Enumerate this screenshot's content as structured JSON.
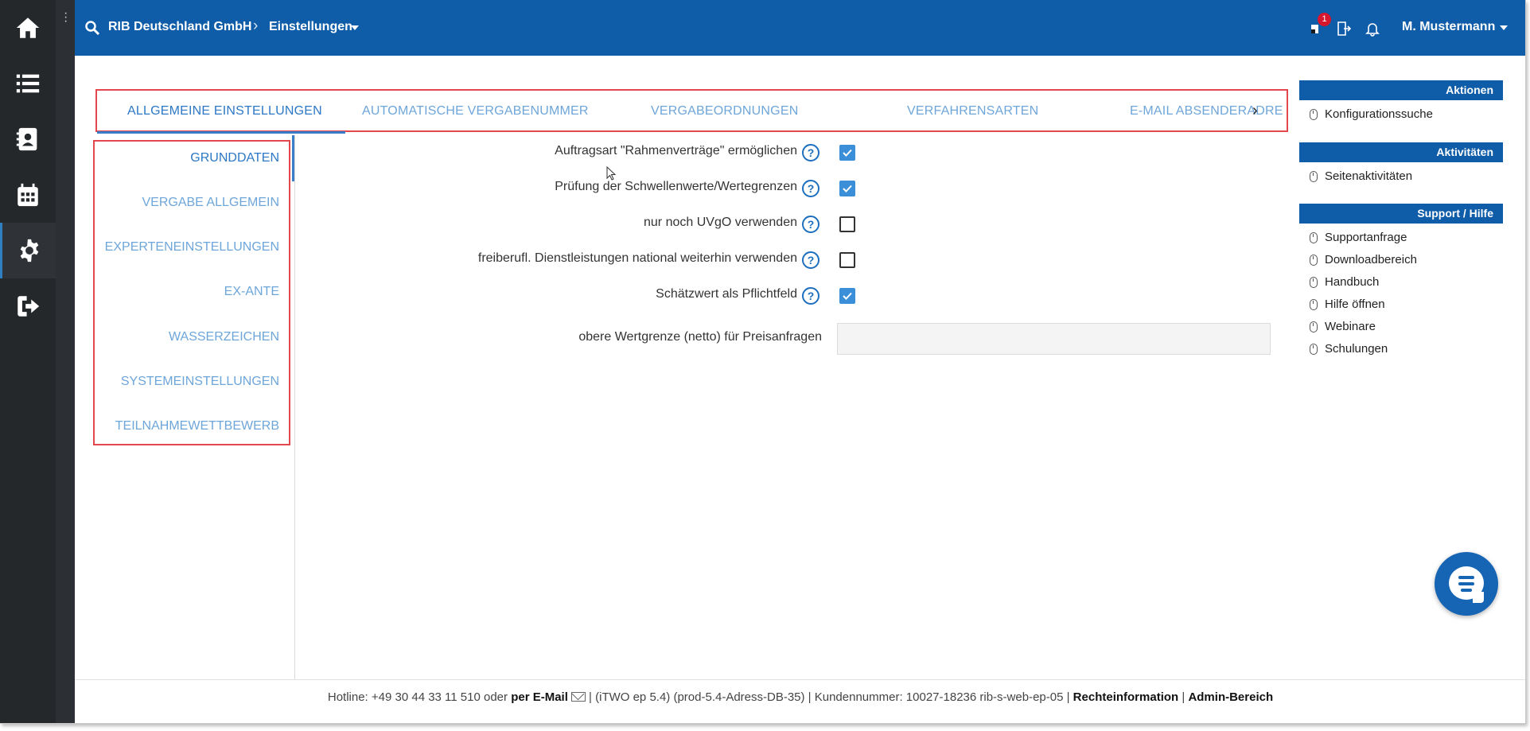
{
  "header": {
    "org_crumb": "RIB Deutschland GmbH",
    "section_crumb": "Einstellungen",
    "notification_count": "1",
    "user_name": "M. Mustermann"
  },
  "sidebar": {
    "items": [
      {
        "icon": "home-icon"
      },
      {
        "icon": "list-icon"
      },
      {
        "icon": "contacts-icon"
      },
      {
        "icon": "calendar-icon"
      },
      {
        "icon": "gear-icon",
        "active": true
      },
      {
        "icon": "logout-icon"
      }
    ]
  },
  "tabs": [
    {
      "label": "ALLGEMEINE EINSTELLUNGEN",
      "active": true
    },
    {
      "label": "AUTOMATISCHE VERGABENUMMER"
    },
    {
      "label": "VERGABEORDNUNGEN"
    },
    {
      "label": "VERFAHRENSARTEN"
    },
    {
      "label": "E-MAIL ABSENDERADRES"
    }
  ],
  "subnav": [
    {
      "label": "GRUNDDATEN",
      "active": true
    },
    {
      "label": "VERGABE ALLGEMEIN"
    },
    {
      "label": "EXPERTENEINSTELLUNGEN"
    },
    {
      "label": "EX-ANTE"
    },
    {
      "label": "WASSERZEICHEN"
    },
    {
      "label": "SYSTEMEINSTELLUNGEN"
    },
    {
      "label": "TEILNAHMEWETTBEWERB"
    }
  ],
  "form": {
    "rows": [
      {
        "label": "Auftragsart \"Rahmenverträge\" ermöglichen",
        "checked": true
      },
      {
        "label": "Prüfung der Schwellenwerte/Wertegrenzen",
        "checked": true
      },
      {
        "label": "nur noch UVgO verwenden",
        "checked": false
      },
      {
        "label": "freiberufl. Dienstleistungen national weiterhin verwenden",
        "checked": false
      },
      {
        "label": "Schätzwert als Pflichtfeld",
        "checked": true
      }
    ],
    "price_limit_label": "obere Wertgrenze (netto) für Preisanfragen",
    "price_limit_value": ""
  },
  "right_panel": {
    "aktionen": {
      "title": "Aktionen",
      "items": [
        "Konfigurationssuche"
      ]
    },
    "aktivitaeten": {
      "title": "Aktivitäten",
      "items": [
        "Seitenaktivitäten"
      ]
    },
    "support": {
      "title": "Support / Hilfe",
      "items": [
        "Supportanfrage",
        "Downloadbereich",
        "Handbuch",
        "Hilfe öffnen",
        "Webinare",
        "Schulungen"
      ]
    }
  },
  "footer": {
    "hotline": "Hotline: +49 30 44 33 11 510 oder",
    "email_link": "per E-Mail",
    "version": "|  (iTWO ep 5.4) (prod-5.4-Adress-DB-35)  |  Kundennummer: 10027-18236 rib-s-web-ep-05 |",
    "legal_link": "Rechteinformation",
    "sep": "|",
    "admin_link": "Admin-Bereich"
  },
  "colors": {
    "header_blue": "#0f5ca8",
    "sidebar_dark": "#25282b",
    "tab_text": "#6ea6da",
    "tab_active": "#2c78c6",
    "highlight_red": "#e5474f",
    "checkbox_blue": "#3a8fd8"
  }
}
